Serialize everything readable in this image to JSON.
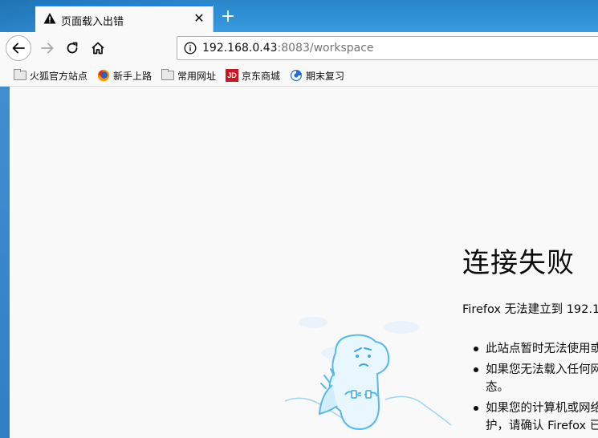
{
  "window": {
    "tab_title": "页面载入出错",
    "tab_close": "✕",
    "new_tab": "+"
  },
  "navbar": {
    "url_host": "192.168.0.43",
    "url_rest": ":8083/workspace"
  },
  "bookmarks": [
    {
      "label": "火狐官方站点",
      "icon": "folder-icon"
    },
    {
      "label": "新手上路",
      "icon": "firefox-icon"
    },
    {
      "label": "常用网址",
      "icon": "folder-icon"
    },
    {
      "label": "京东商城",
      "icon": "jd-icon",
      "icon_text": "JD"
    },
    {
      "label": "期末复习",
      "icon": "globe-icon"
    }
  ],
  "error": {
    "title": "连接失败",
    "description": "Firefox 无法建立到 192.1",
    "items": [
      "此站点暂时无法使用或",
      "如果您无法载入任何网",
      "态。",
      "如果您的计算机或网络",
      "护，请确认 Firefox 已"
    ]
  },
  "colors": {
    "accent": "#0a84ff",
    "titlebar": "#2f8fd4",
    "jd_red": "#c81623"
  }
}
